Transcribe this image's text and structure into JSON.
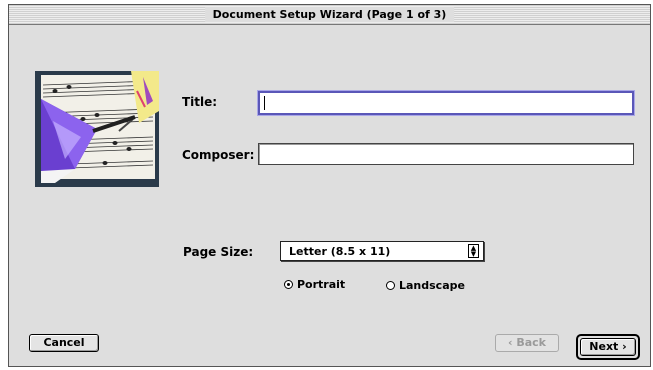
{
  "window": {
    "title": "Document Setup Wizard (Page 1 of 3)"
  },
  "form": {
    "title_label": "Title:",
    "title_value": "",
    "composer_label": "Composer:",
    "composer_value": "",
    "page_size_label": "Page Size:",
    "page_size_selected": "Letter (8.5 x 11)",
    "orientation": {
      "options": [
        "Portrait",
        "Landscape"
      ],
      "selected": "Portrait"
    }
  },
  "buttons": {
    "cancel": "Cancel",
    "back": "‹ Back",
    "next": "Next ›"
  },
  "icons": {
    "illustration": "music-score-with-quill-icon",
    "popup_arrows": "up-down-arrows-icon"
  }
}
